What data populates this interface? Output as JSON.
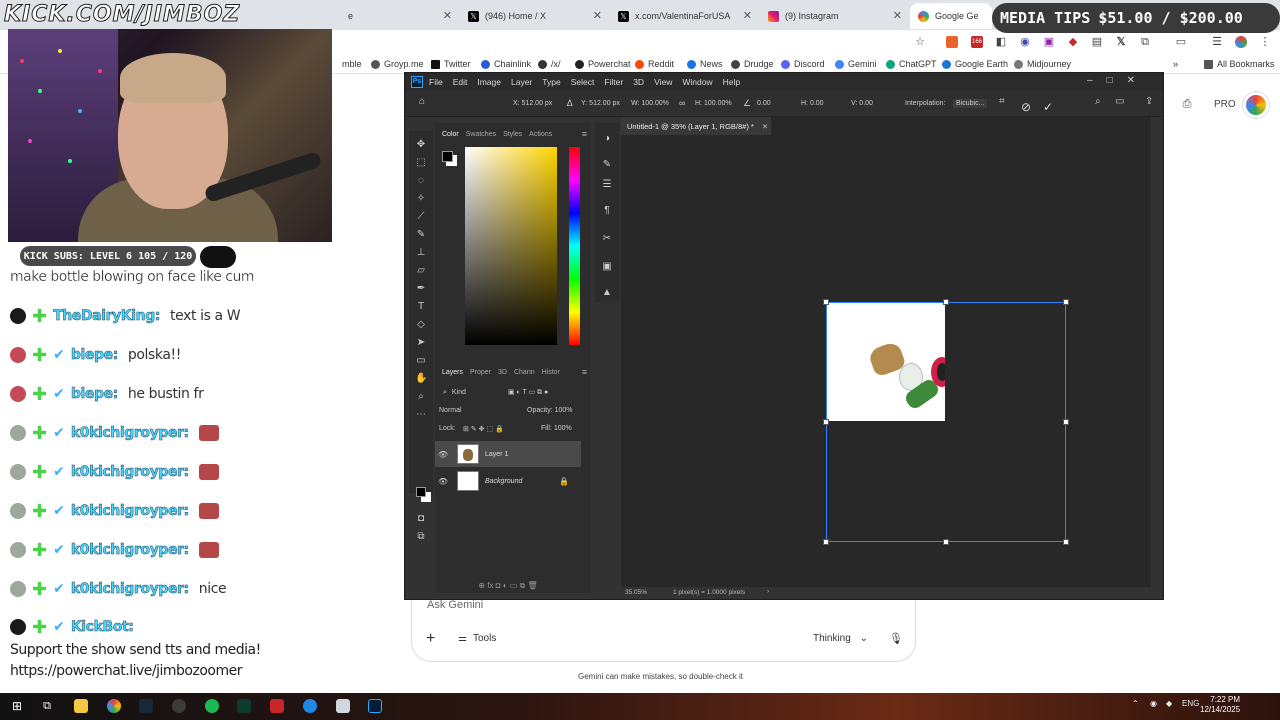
{
  "browser": {
    "tabs": [
      {
        "label": "e"
      },
      {
        "label": "(946) Home / X",
        "icon": "x-logo-icon"
      },
      {
        "label": "x.com/ValentinaForUSA",
        "icon": "x-logo-icon"
      },
      {
        "label": "(9) Instagram",
        "icon": "instagram-icon"
      },
      {
        "label": "Google Ge",
        "icon": "google-icon"
      }
    ],
    "bookmarks": [
      {
        "label": "mble"
      },
      {
        "label": "Groyp.me"
      },
      {
        "label": "Twitter"
      },
      {
        "label": "Chainlink"
      },
      {
        "label": "/x/"
      },
      {
        "label": "Powerchat"
      },
      {
        "label": "Reddit"
      },
      {
        "label": "News"
      },
      {
        "label": "Drudge"
      },
      {
        "label": "Discord"
      },
      {
        "label": "Gemini"
      },
      {
        "label": "ChatGPT"
      },
      {
        "label": "Google Earth"
      },
      {
        "label": "Midjourney"
      }
    ],
    "all_bookmarks": "All Bookmarks",
    "extension_badge": "166"
  },
  "overlay": {
    "title": "KICK.COM/JIMBOZ",
    "media_tips_label": "MEDIA TIPS",
    "media_tips_amount": "$51.00 / $200.00",
    "subs_text": "KICK SUBS: LEVEL 6 105 / 120"
  },
  "chat": {
    "top_message": "make bottle blowing on face like cum",
    "lines": [
      {
        "user": "TheDairyKing:",
        "msg": "text is a W",
        "badge_color": "#1a1a1a"
      },
      {
        "user": "biepe:",
        "msg": "polska!!",
        "badge_color": "#c44a5a"
      },
      {
        "user": "biepe:",
        "msg": "he bustin fr",
        "badge_color": "#c44a5a"
      },
      {
        "user": "k0kichigroyper:",
        "msg": "",
        "badge_color": "#9ca89c"
      },
      {
        "user": "k0kichigroyper:",
        "msg": "",
        "badge_color": "#9ca89c"
      },
      {
        "user": "k0kichigroyper:",
        "msg": "",
        "badge_color": "#9ca89c"
      },
      {
        "user": "k0kichigroyper:",
        "msg": "",
        "badge_color": "#9ca89c"
      },
      {
        "user": "k0kichigroyper:",
        "msg": "nice",
        "badge_color": "#9ca89c"
      },
      {
        "user": "KickBot:",
        "msg": "",
        "badge_color": "#1a1a1a"
      }
    ],
    "kickbot_line1": "Support the show send tts and media!",
    "kickbot_line2": "https://powerchat.live/jimbozoomer"
  },
  "gemini": {
    "placeholder": "Ask Gemini",
    "tools": "Tools",
    "mode": "Thinking",
    "disclaimer": "Gemini can make mistakes, so double-check it",
    "pro": "PRO"
  },
  "photoshop": {
    "menu": [
      "File",
      "Edit",
      "Image",
      "Layer",
      "Type",
      "Select",
      "Filter",
      "3D",
      "View",
      "Window",
      "Help"
    ],
    "options": {
      "x": "X: 512.00 px",
      "y": "Y: 512.00 px",
      "w": "W: 100.00%",
      "h": "H: 100.00%",
      "angle": "0.00",
      "hskew": "H: 0.00",
      "vskew": "V: 0.00",
      "interp_label": "Interpolation:",
      "interp_value": "Bicubic..."
    },
    "color_tabs": [
      "Color",
      "Swatches",
      "Styles",
      "Actions"
    ],
    "layer_tabs": [
      "Layers",
      "Proper",
      "3D",
      "Chann",
      "Histor"
    ],
    "kind": "Kind",
    "blend": "Normal",
    "opacity": "Opacity: 100%",
    "lock": "Lock:",
    "fill": "Fill: 100%",
    "layers": [
      {
        "name": "Layer 1",
        "selected": true
      },
      {
        "name": "Background",
        "selected": false
      }
    ],
    "doc_tab": "Untitled-1 @ 35% (Layer 1, RGB/8#) *",
    "zoom": "35.05%",
    "status": "1 pixel(s) = 1.0000 pixels",
    "accent": "#31a8ff"
  },
  "taskbar": {
    "lang": "ENG",
    "time": "7:22 PM",
    "date": "12/14/2025"
  }
}
